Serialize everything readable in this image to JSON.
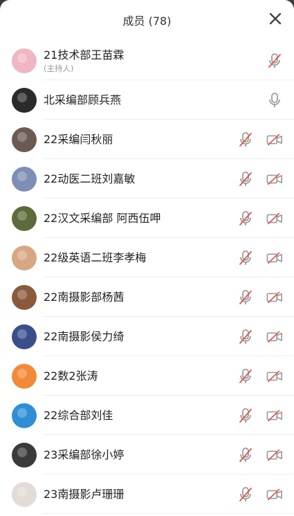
{
  "header": {
    "title": "成员 (78)"
  },
  "members": [
    {
      "name": "21技术部王苗霖",
      "subtitle": "(主持人)",
      "avatar_color": "#f0b7c2",
      "mic": "muted",
      "camera": false
    },
    {
      "name": "北采编部顾兵燕",
      "subtitle": "",
      "avatar_color": "#2b2b2b",
      "mic": "on",
      "camera": false
    },
    {
      "name": "22采编闫秋丽",
      "subtitle": "",
      "avatar_color": "#6b5a52",
      "mic": "muted",
      "camera": true
    },
    {
      "name": "22动医二班刘嘉敏",
      "subtitle": "",
      "avatar_color": "#7d8fb5",
      "mic": "muted",
      "camera": true
    },
    {
      "name": "22汉文采编部 阿西伍呷",
      "subtitle": "",
      "avatar_color": "#5d6a3c",
      "mic": "muted",
      "camera": true
    },
    {
      "name": "22级英语二班李孝梅",
      "subtitle": "",
      "avatar_color": "#d7a783",
      "mic": "muted",
      "camera": true
    },
    {
      "name": "22南摄影部杨茜",
      "subtitle": "",
      "avatar_color": "#8a5a3c",
      "mic": "muted",
      "camera": true
    },
    {
      "name": "22南摄影侯力绮",
      "subtitle": "",
      "avatar_color": "#3a4f8a",
      "mic": "muted",
      "camera": true
    },
    {
      "name": "22数2张涛",
      "subtitle": "",
      "avatar_color": "#f28a3a",
      "mic": "muted",
      "camera": true
    },
    {
      "name": "22综合部刘佳",
      "subtitle": "",
      "avatar_color": "#2f8fd6",
      "mic": "muted",
      "camera": true
    },
    {
      "name": "23采编部徐小婷",
      "subtitle": "",
      "avatar_color": "#3a3a3a",
      "mic": "muted",
      "camera": true
    },
    {
      "name": "23南摄影卢珊珊",
      "subtitle": "",
      "avatar_color": "#e3dcd6",
      "mic": "muted",
      "camera": true
    }
  ],
  "colors": {
    "icon_gray": "#9a9a9a",
    "mute_red": "#e0554a"
  }
}
